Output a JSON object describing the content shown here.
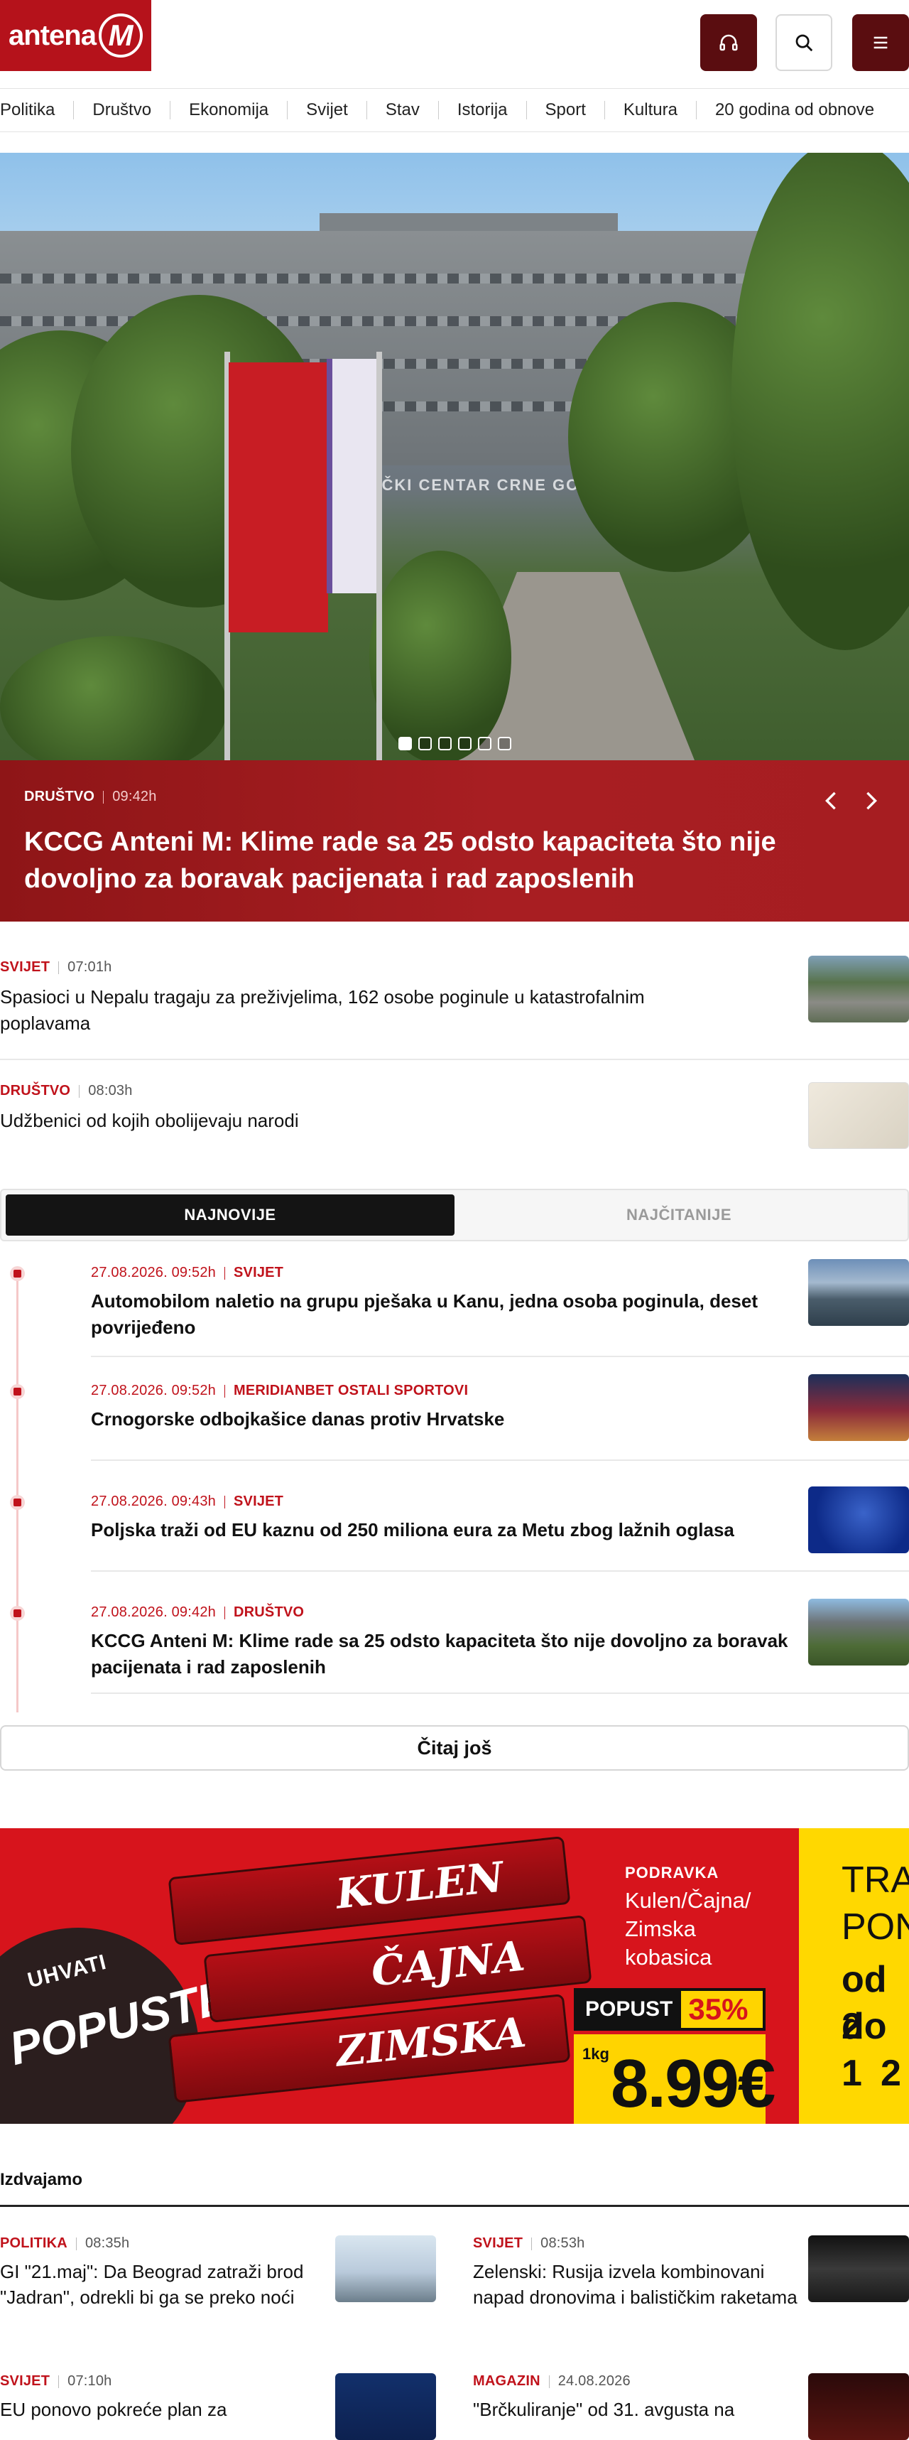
{
  "header": {
    "logo_text": "antena",
    "logo_letter": "M",
    "audio_icon": "headphones-icon",
    "search_icon": "search-icon",
    "menu_icon": "hamburger-menu-icon"
  },
  "nav": [
    "Politika",
    "Društvo",
    "Ekonomija",
    "Svijet",
    "Stav",
    "Istorija",
    "Sport",
    "Kultura",
    "20 godina od obnove"
  ],
  "hero": {
    "image_sign": "KLINIČKI CENTAR CRNE GORE",
    "category": "DRUŠTVO",
    "time": "09:42h",
    "title": "KCCG Anteni M: Klime rade sa 25 odsto kapaciteta što nije dovoljno za boravak pacijenata i rad zaposlenih",
    "slides": 6,
    "active_slide": 1
  },
  "top_news": [
    {
      "category": "SVIJET",
      "time": "07:01h",
      "title": "Spasioci u Nepalu tragaju za preživjelima, 162 osobe poginule u katastrofalnim poplavama"
    },
    {
      "category": "DRUŠTVO",
      "time": "08:03h",
      "title": "Udžbenici od kojih obolijevaju narodi"
    }
  ],
  "tabs": {
    "latest": "NAJNOVIJE",
    "most_read": "NAJČITANIJE",
    "active": "latest"
  },
  "timeline": [
    {
      "date": "27.08.2026. 09:52h",
      "category": "SVIJET",
      "title": "Automobilom naletio na grupu pješaka u Kanu, jedna osoba poginula, deset povrijeđeno"
    },
    {
      "date": "27.08.2026. 09:52h",
      "category": "MERIDIANBET OSTALI SPORTOVI",
      "title": "Crnogorske odbojkašice danas protiv Hrvatske"
    },
    {
      "date": "27.08.2026. 09:43h",
      "category": "SVIJET",
      "title": "Poljska traži od EU kaznu od 250 miliona eura za Metu zbog lažnih oglasa"
    },
    {
      "date": "27.08.2026. 09:42h",
      "category": "DRUŠTVO",
      "title": "KCCG Anteni M: Klime rade sa 25 odsto kapaciteta što nije dovoljno za boravak pacijenata i rad zaposlenih"
    }
  ],
  "more_label": "Čitaj još",
  "banner": {
    "uhvati": "UHVATI",
    "popuste": "POPUSTE",
    "products": [
      "KULEN",
      "ČAJNA",
      "ZIMSKA"
    ],
    "brand": "PODRAVKA",
    "product_names": "Kulen/Čajna/ Zimska kobasica",
    "popust_label": "POPUST",
    "popust_pct": "35%",
    "unit": "1kg",
    "price": "8.99€",
    "side_text": [
      "TRA",
      "PON",
      "od 2",
      "do 1",
      "2"
    ]
  },
  "section": {
    "title": "Izdvajamo",
    "cards": [
      {
        "category": "POLITIKA",
        "time": "08:35h",
        "title": "GI \"21.maj\": Da Beograd zatraži brod \"Jadran\", odrekli bi ga se preko noći"
      },
      {
        "category": "SVIJET",
        "time": "08:53h",
        "title": "Zelenski: Rusija izvela kombinovani napad dronovima i balističkim raketama"
      },
      {
        "category": "SVIJET",
        "time": "07:10h",
        "title": "EU ponovo pokreće plan za"
      },
      {
        "category": "MAGAZIN",
        "time": "24.08.2026",
        "title": "\"Brčkuliranje\" od 31. avgusta na"
      }
    ]
  },
  "colors": {
    "brand_red": "#b5121b",
    "dark_red": "#5a0d10",
    "accent_red": "#c0121b",
    "tab_dark": "#141414"
  }
}
